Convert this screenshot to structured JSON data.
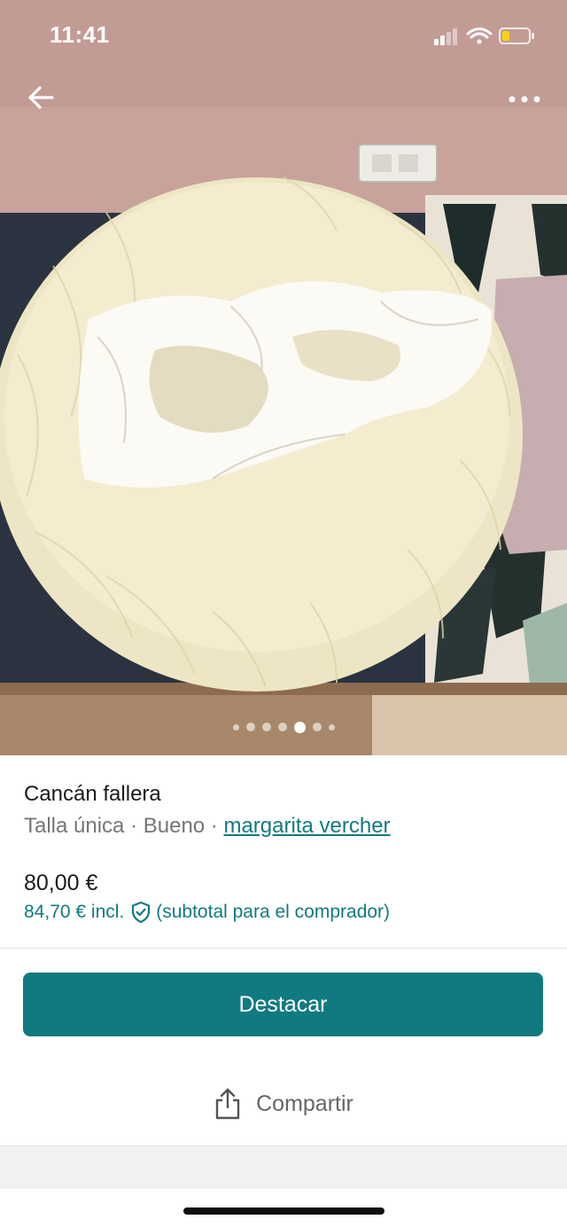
{
  "status_bar": {
    "time": "11:41"
  },
  "nav": {
    "back_icon": "arrow-left-icon",
    "more_icon": "more-horizontal-icon"
  },
  "gallery": {
    "photo_subject": "cream tulle petticoat (cancán) on a bed",
    "page_count": 7,
    "active_page": 5
  },
  "item": {
    "title": "Cancán fallera",
    "size": "Talla única",
    "separator": " · ",
    "condition": "Bueno",
    "seller": "margarita vercher",
    "price": "80,00 €",
    "price_incl": "84,70 € incl.",
    "buyer_note": "(subtotal para el comprador)"
  },
  "actions": {
    "primary_label": "Destacar",
    "share_label": "Compartir"
  },
  "colors": {
    "accent": "#117a81",
    "text_primary": "#1b1b1b",
    "text_secondary": "#757575"
  }
}
